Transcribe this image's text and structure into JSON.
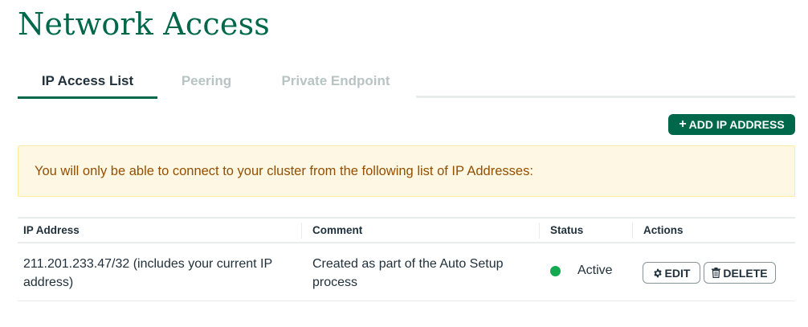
{
  "page": {
    "title": "Network Access"
  },
  "tabs": [
    {
      "label": "IP Access List",
      "active": true
    },
    {
      "label": "Peering",
      "active": false
    },
    {
      "label": "Private Endpoint",
      "active": false
    }
  ],
  "toolbar": {
    "add_label": "ADD IP ADDRESS",
    "add_icon": "plus-icon"
  },
  "banner": {
    "text": "You will only be able to connect to your cluster from the following list of IP Addresses:"
  },
  "table": {
    "headers": {
      "ip": "IP Address",
      "comment": "Comment",
      "status": "Status",
      "actions": "Actions"
    },
    "rows": [
      {
        "ip": "211.201.233.47/32  (includes your current IP address)",
        "comment": "Created as part of the Auto Setup process",
        "status": "Active",
        "edit_label": "EDIT",
        "delete_label": "DELETE"
      }
    ]
  },
  "colors": {
    "brand": "#00684a",
    "status_active": "#13aa52",
    "banner_bg": "#fef7e3",
    "banner_text": "#944f01"
  },
  "icons": {
    "edit": "gear-icon",
    "delete": "trash-icon"
  }
}
